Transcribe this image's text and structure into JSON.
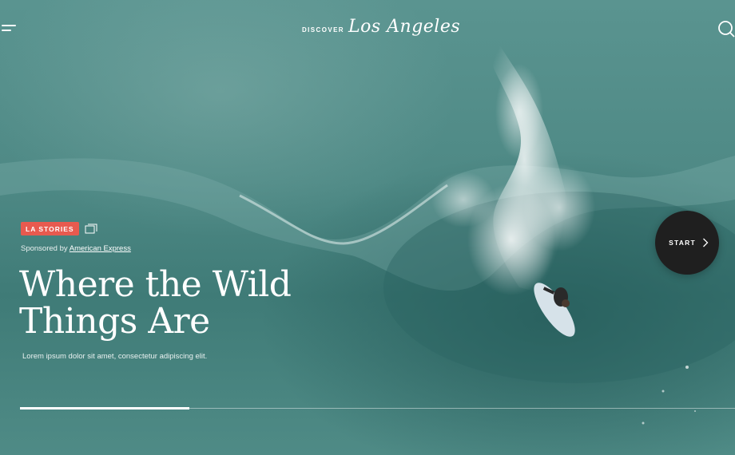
{
  "header": {
    "logo_small": "DISCOVER",
    "logo_script": "Los Angeles",
    "menu_icon": "menu-icon",
    "search_icon": "search-icon"
  },
  "article": {
    "tag": "LA STORIES",
    "tag_color": "#e85a4f",
    "gallery_icon": "gallery-icon",
    "sponsor_prefix": "Sponsored by",
    "sponsor_name": "American Express",
    "title_line1": "Where the Wild",
    "title_line2": "Things Are",
    "description": "Lorem ipsum dolor sit amet, consectetur adipiscing elit."
  },
  "progress": {
    "value": 0.237
  },
  "start_button": {
    "label": "START",
    "icon": "chevron-right-icon",
    "color": "#1f1f1f"
  },
  "background": {
    "image": "surfer-on-wave-photo"
  }
}
